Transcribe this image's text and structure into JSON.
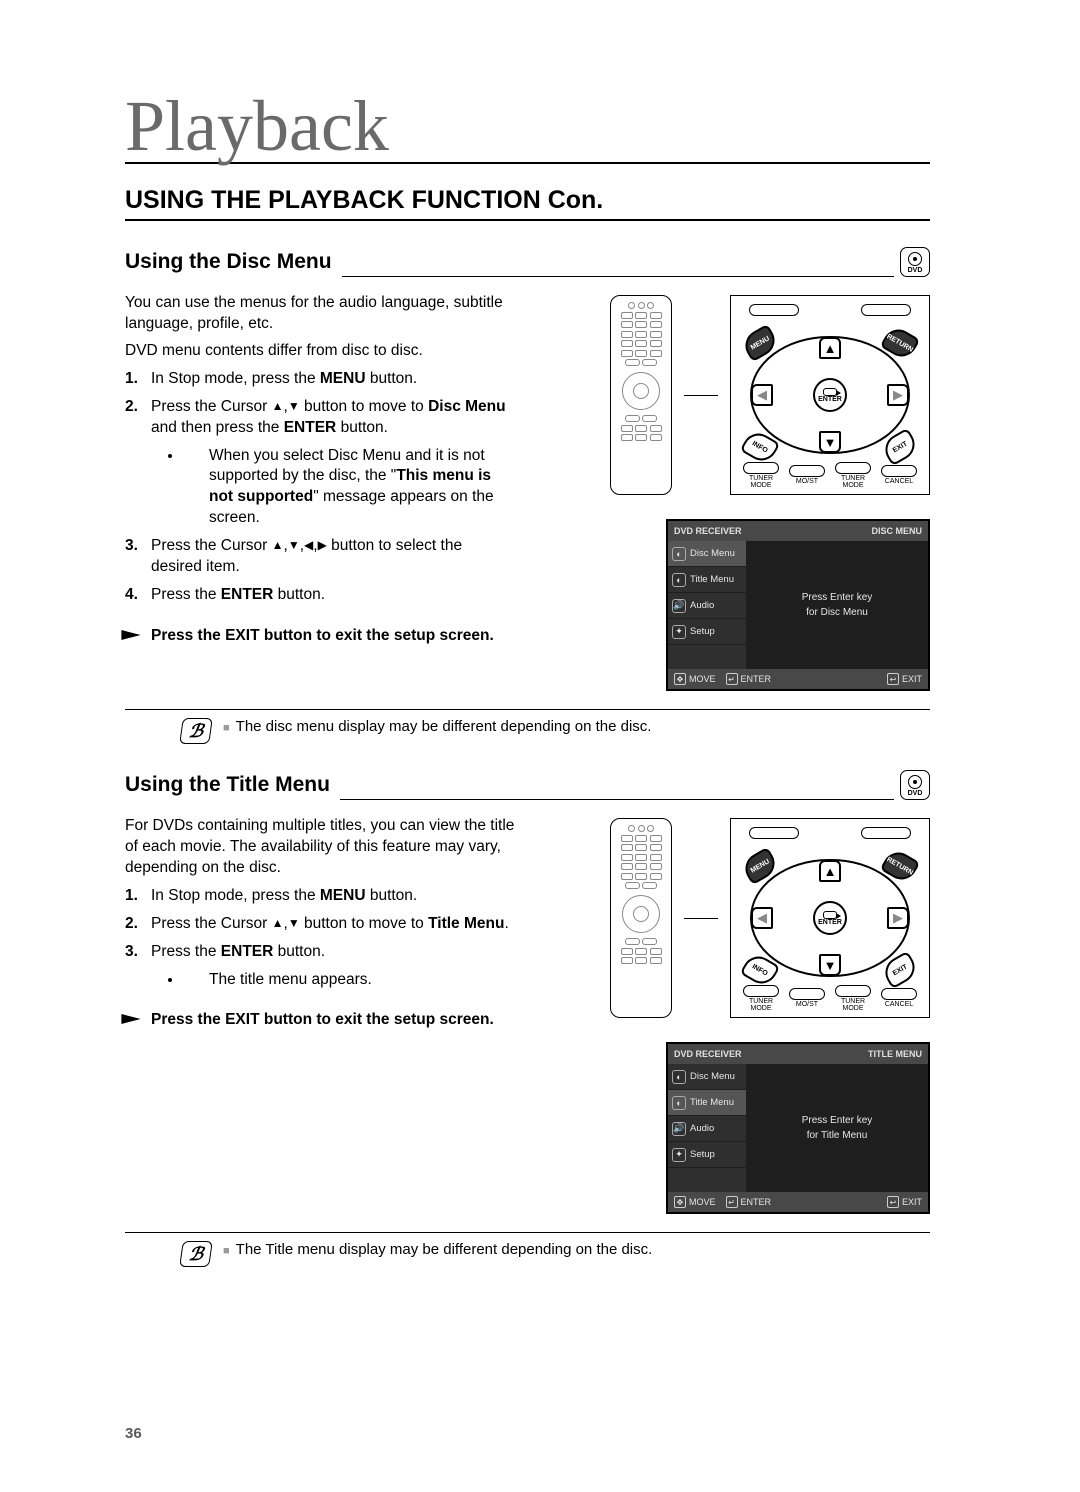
{
  "page": {
    "title": "Playback",
    "section_heading": "USING THE PLAYBACK FUNCTION Con.",
    "page_number": "36"
  },
  "dvd_icon_label": "DVD",
  "disc_menu": {
    "heading": "Using the Disc Menu",
    "intro1": "You can use the menus for the audio language, subtitle language, profile, etc.",
    "intro2": "DVD menu contents differ from disc to disc.",
    "step1_num": "1.",
    "step1_a": "In Stop mode, press the ",
    "step1_b": "MENU",
    "step1_c": " button.",
    "step2_num": "2.",
    "step2_a": "Press the Cursor ",
    "step2_b": " button to move to ",
    "step2_c": "Disc Menu",
    "step2_d": " and then press the ",
    "step2_e": "ENTER",
    "step2_f": " button.",
    "step2_bullet_a": "When you select Disc Menu and it is not supported by the disc, the \"",
    "step2_bullet_b": "This menu is not supported",
    "step2_bullet_c": "\" message appears on the screen.",
    "step3_num": "3.",
    "step3_a": "Press the Cursor ",
    "step3_b": " button to select the desired item.",
    "step4_num": "4.",
    "step4_a": "Press the ",
    "step4_b": "ENTER",
    "step4_c": " button.",
    "exit": "Press the EXIT button to exit the setup screen.",
    "note": "The disc menu display may be different depending on the disc."
  },
  "title_menu": {
    "heading": "Using the Title Menu",
    "intro": "For DVDs containing multiple titles, you can view the title of each movie. The availability of this feature may vary, depending on the disc.",
    "step1_num": "1.",
    "step1_a": "In Stop mode, press the ",
    "step1_b": "MENU",
    "step1_c": " button.",
    "step2_num": "2.",
    "step2_a": "Press the Cursor ",
    "step2_b": " button to move to ",
    "step2_c": "Title Menu",
    "step2_d": ".",
    "step3_num": "3.",
    "step3_a": "Press the ",
    "step3_b": "ENTER",
    "step3_c": " button.",
    "step3_bullet": "The title menu appears.",
    "exit": "Press the EXIT button to exit the setup screen.",
    "note": "The Title menu display may be different depending on the disc."
  },
  "dpad": {
    "corner_tl": "MENU",
    "corner_tr": "RETURN",
    "corner_bl": "INFO",
    "corner_br": "EXIT",
    "center": "ENTER",
    "rail1": "TUNER MODE",
    "rail2": "MO/ST",
    "rail3": "TUNER MODE",
    "rail4": "CANCEL"
  },
  "osd_disc": {
    "header_left": "DVD RECEIVER",
    "header_right": "DISC MENU",
    "side": [
      "Disc Menu",
      "Title Menu",
      "Audio",
      "Setup"
    ],
    "main_line1": "Press Enter key",
    "main_line2": "for Disc Menu",
    "footer_move": "MOVE",
    "footer_enter": "ENTER",
    "footer_exit": "EXIT"
  },
  "osd_title": {
    "header_left": "DVD RECEIVER",
    "header_right": "TITLE MENU",
    "side": [
      "Disc Menu",
      "Title Menu",
      "Audio",
      "Setup"
    ],
    "main_line1": "Press Enter key",
    "main_line2": "for Title Menu",
    "footer_move": "MOVE",
    "footer_enter": "ENTER",
    "footer_exit": "EXIT"
  }
}
